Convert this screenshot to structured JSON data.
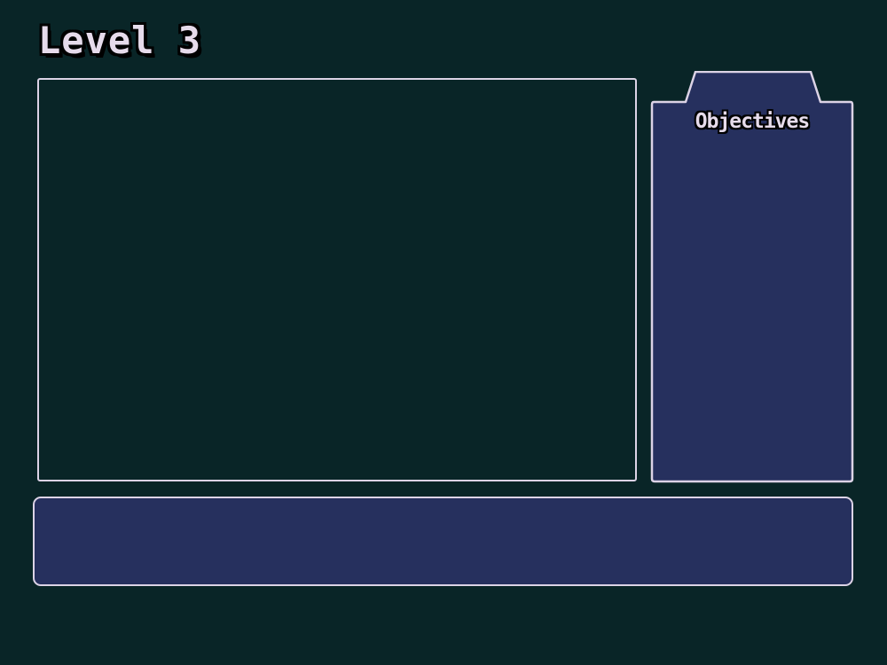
{
  "hud": {
    "level_title": "Level 3"
  },
  "objectives": {
    "title": "Objectives",
    "items": []
  },
  "dialog": {
    "text": ""
  },
  "colors": {
    "background": "#092527",
    "panel_fill": "#26305e",
    "border": "#dcd3e6",
    "text": "#e6dbeb",
    "text_outline": "#000000"
  }
}
